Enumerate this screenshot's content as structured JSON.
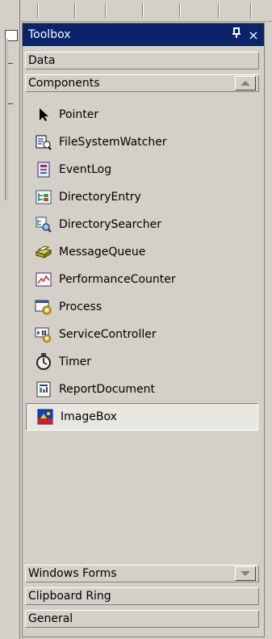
{
  "toolbox": {
    "title": "Toolbox",
    "pin_glyph": "ᴪ",
    "close_glyph": "×"
  },
  "tabs": {
    "data": "Data",
    "components": "Components",
    "windows_forms": "Windows Forms",
    "clipboard_ring": "Clipboard Ring",
    "general": "General"
  },
  "components": [
    {
      "label": "Pointer",
      "icon": "pointer-icon"
    },
    {
      "label": "FileSystemWatcher",
      "icon": "filesystemwatcher-icon"
    },
    {
      "label": "EventLog",
      "icon": "eventlog-icon"
    },
    {
      "label": "DirectoryEntry",
      "icon": "directoryentry-icon"
    },
    {
      "label": "DirectorySearcher",
      "icon": "directorysearcher-icon"
    },
    {
      "label": "MessageQueue",
      "icon": "messagequeue-icon"
    },
    {
      "label": "PerformanceCounter",
      "icon": "performancecounter-icon"
    },
    {
      "label": "Process",
      "icon": "process-icon"
    },
    {
      "label": "ServiceController",
      "icon": "servicecontroller-icon"
    },
    {
      "label": "Timer",
      "icon": "timer-icon"
    },
    {
      "label": "ReportDocument",
      "icon": "reportdocument-icon"
    },
    {
      "label": "ImageBox",
      "icon": "imagebox-icon",
      "selected": true
    }
  ],
  "colors": {
    "titlebar": "#0a246a",
    "face": "#d4d0c8",
    "selected_item": "#e8e6e0"
  }
}
